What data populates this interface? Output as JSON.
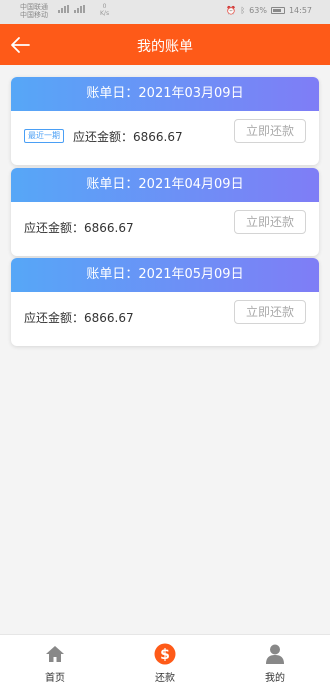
{
  "statusbar": {
    "carrier1": "中国联通",
    "carrier2": "中国移动",
    "net_speed": "0",
    "net_unit": "K/s",
    "battery": "63%",
    "time": "14:57"
  },
  "header": {
    "title": "我的账单"
  },
  "bills": [
    {
      "date_label": "账单日：2021年03月09日",
      "tag": "最近一期",
      "amount_label": "应还金额：6866.67",
      "pay_label": "立即还款"
    },
    {
      "date_label": "账单日：2021年04月09日",
      "amount_label": "应还金额：6866.67",
      "pay_label": "立即还款"
    },
    {
      "date_label": "账单日：2021年05月09日",
      "amount_label": "应还金额：6866.67",
      "pay_label": "立即还款"
    }
  ],
  "tabbar": {
    "home_label": "首页",
    "repay_label": "还款",
    "mine_label": "我的"
  },
  "colors": {
    "accent": "#fe5a18",
    "gradient_start": "#56a7f7",
    "gradient_end": "#7f7df6",
    "tag_blue": "#4a9ff5"
  }
}
